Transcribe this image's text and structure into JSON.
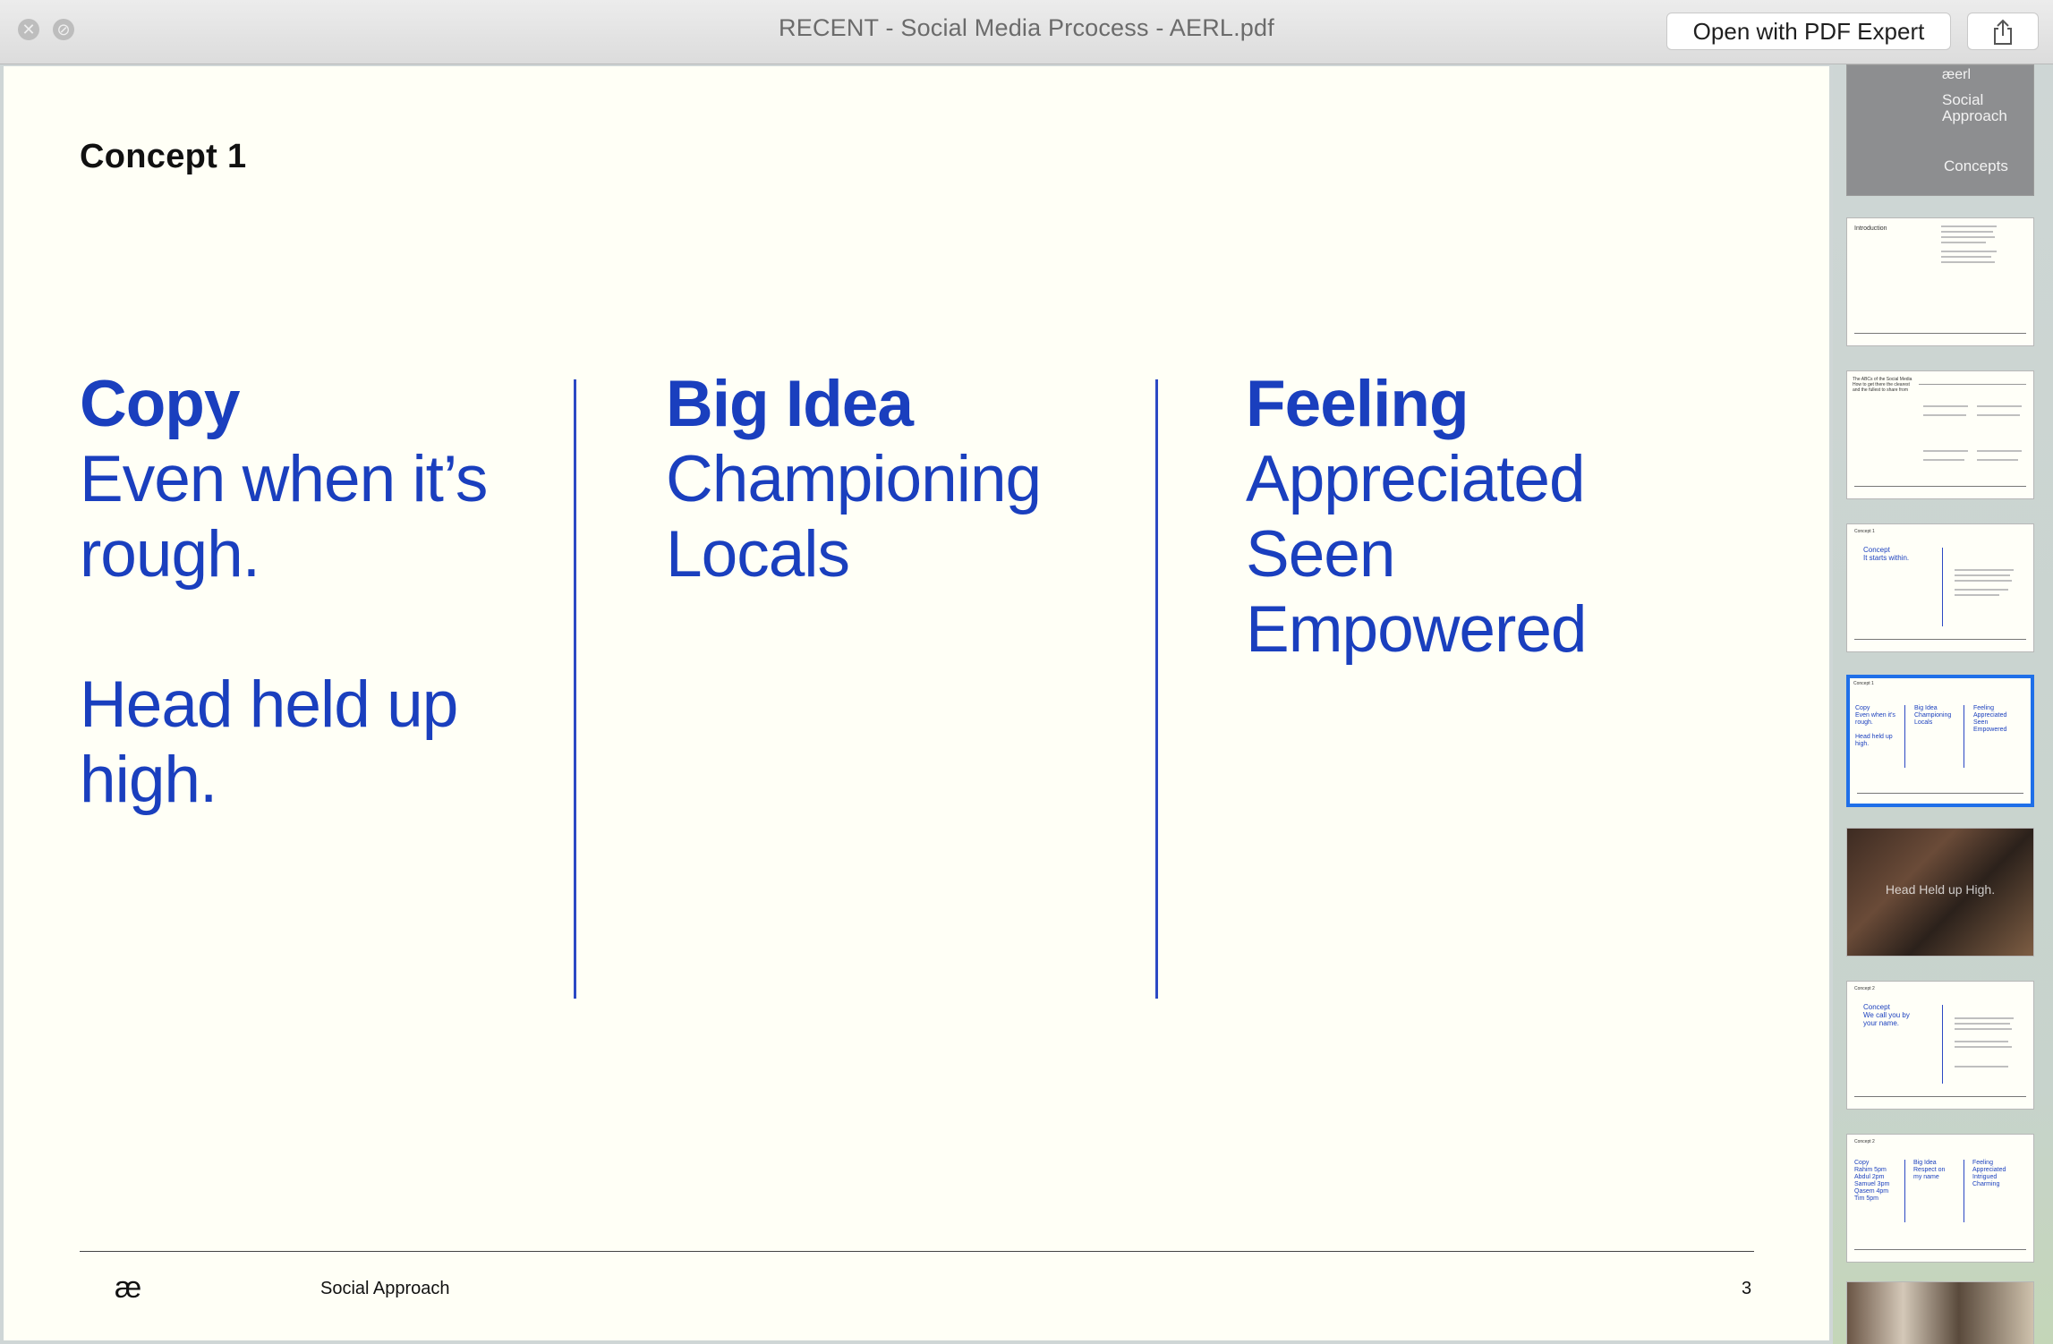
{
  "window": {
    "title": "RECENT - Social Media Prcocess - AERL.pdf",
    "open_button": "Open with PDF Expert",
    "close_glyph": "✕",
    "minimize_glyph": "⊘",
    "share_icon": "share-icon"
  },
  "slide": {
    "heading": "Concept 1",
    "columns": [
      {
        "head": "Copy",
        "lines": [
          "Even when it’s",
          "rough.",
          "",
          "Head held up",
          "high."
        ]
      },
      {
        "head": "Big Idea",
        "lines": [
          "Championing",
          "Locals"
        ]
      },
      {
        "head": "Feeling",
        "lines": [
          "Appreciated",
          "Seen",
          "Empowered"
        ]
      }
    ],
    "footer": {
      "logo": "æ",
      "label": "Social Approach",
      "page_number": "3"
    },
    "accent_color": "#1a3fbe"
  },
  "thumbnails": {
    "cover": {
      "brand": "æerl",
      "title": "Social\nApproach",
      "subtitle": "Concepts"
    },
    "t2": {
      "left": "Introduction"
    },
    "t3": {
      "left": "The ABCs of the Social Media\nHow to get there the clearest\nand the fullest to share from"
    },
    "t4": {
      "small": "Concept 1",
      "blue": "Concept\nIt starts within."
    },
    "t5": {
      "small": "Concept 1",
      "c1": "Copy\nEven when it's\nrough.\n\nHead held up\nhigh.",
      "c2": "Big Idea\nChampioning\nLocals",
      "c3": "Feeling\nAppreciated\nSeen\nEmpowered"
    },
    "t6": {
      "caption": "Head Held up High."
    },
    "t7": {
      "small": "Concept 2",
      "blue": "Concept\nWe call you by\nyour name."
    },
    "t8": {
      "small": "Concept 2",
      "c1": "Copy\nRahim 5pm\nAbdul 2pm\nSamuel 3pm\nQasem 4pm\nTim 5pm",
      "c2": "Big Idea\nRespect on\nmy name",
      "c3": "Feeling\nAppreciated\nIntrigued\nCharming"
    }
  }
}
